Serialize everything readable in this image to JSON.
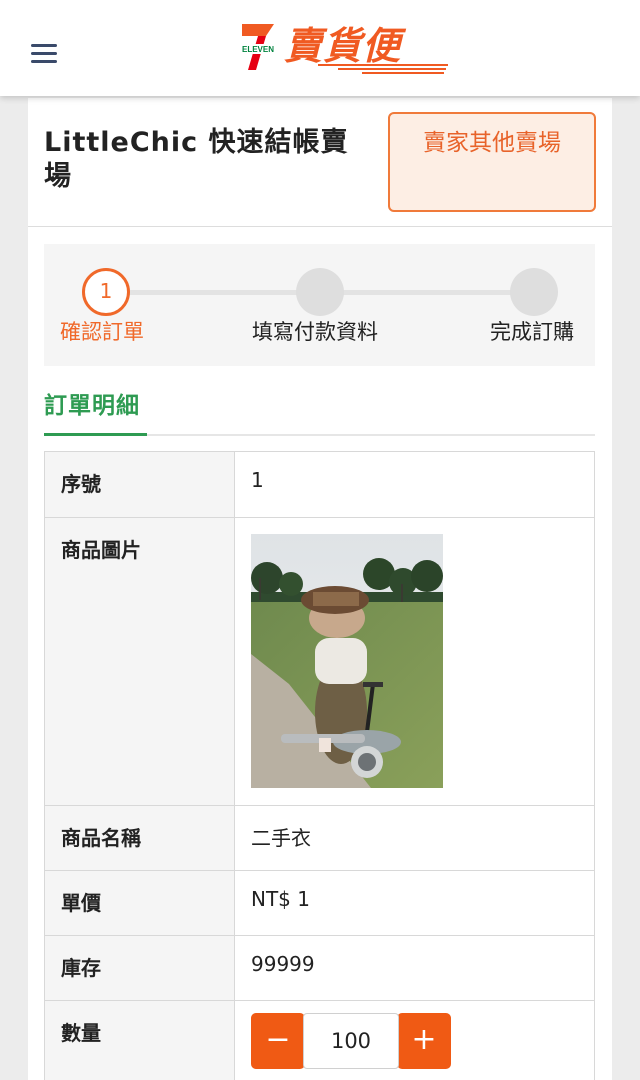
{
  "header": {
    "logo_small_text": "ELEVEN",
    "logo_text": "賣貨便",
    "brand_colors": {
      "orange": "#f05a22",
      "green": "#00833e",
      "red": "#e60012"
    }
  },
  "store": {
    "title": "LittleChic 快速結帳賣場",
    "other_button_label": "賣家其他賣場"
  },
  "steps": [
    {
      "number": "1",
      "label": "確認訂單",
      "active": true
    },
    {
      "number": "",
      "label": "填寫付款資料",
      "active": false
    },
    {
      "number": "",
      "label": "完成訂購",
      "active": false
    }
  ],
  "section": {
    "title": "訂單明細"
  },
  "details": {
    "serial_label": "序號",
    "serial_value": "1",
    "image_label": "商品圖片",
    "name_label": "商品名稱",
    "name_value": "二手衣",
    "price_label": "單價",
    "price_value": "NT$ 1",
    "stock_label": "庫存",
    "stock_value": "99999",
    "qty_label": "數量",
    "qty_value": "100",
    "qty_minus": "−",
    "qty_plus": "+"
  }
}
